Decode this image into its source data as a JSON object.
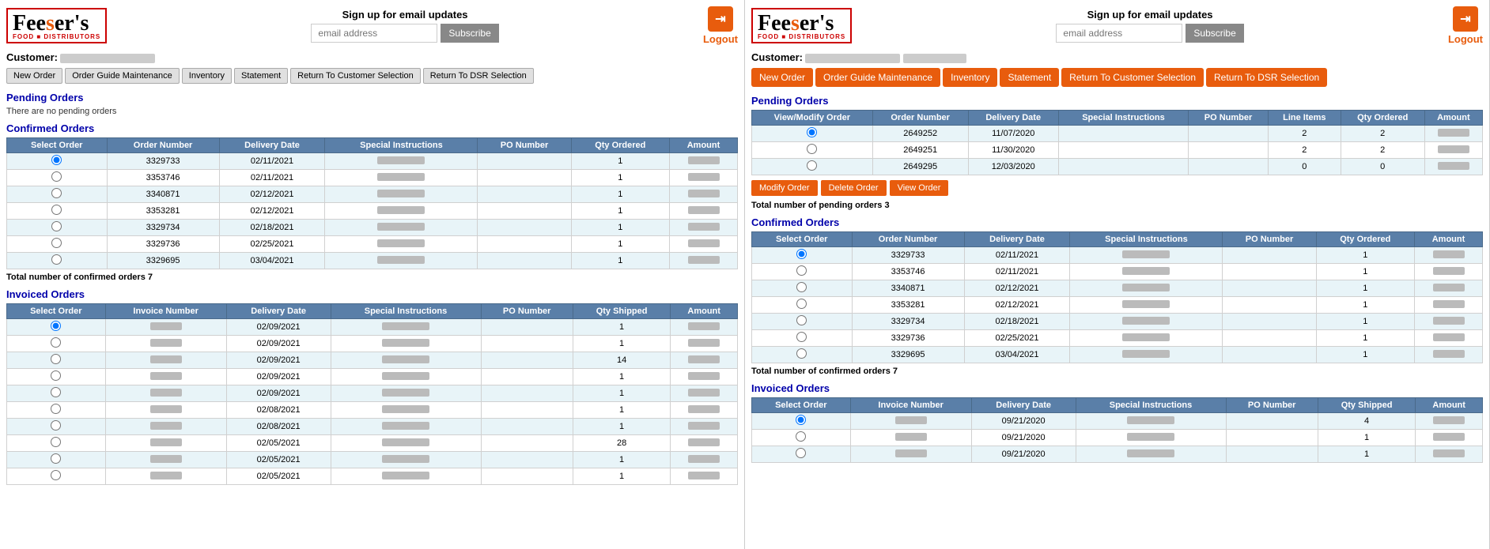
{
  "header": {
    "signup_title": "Sign up for email updates",
    "email_placeholder": "email address",
    "subscribe_label": "Subscribe",
    "logout_label": "Logout"
  },
  "customer": {
    "label": "Customer:"
  },
  "nav_left": {
    "buttons": [
      "New Order",
      "Order Guide Maintenance",
      "Inventory",
      "Statement",
      "Return To Customer Selection",
      "Return To DSR Selection"
    ]
  },
  "nav_right": {
    "buttons": [
      "New Order",
      "Order Guide Maintenance",
      "Inventory",
      "Statement",
      "Return To Customer Selection",
      "Return To DSR Selection"
    ]
  },
  "pending_orders": {
    "title": "Pending Orders",
    "note_left": "There are no pending orders",
    "columns_right": [
      "View/Modify Order",
      "Order Number",
      "Delivery Date",
      "Special Instructions",
      "PO Number",
      "Line Items",
      "Qty Ordered",
      "Amount"
    ],
    "rows_right": [
      {
        "order_number": "2649252",
        "delivery_date": "11/07/2020",
        "line_items": "2",
        "qty_ordered": "2"
      },
      {
        "order_number": "2649251",
        "delivery_date": "11/30/2020",
        "line_items": "2",
        "qty_ordered": "2"
      },
      {
        "order_number": "2649295",
        "delivery_date": "12/03/2020",
        "line_items": "0",
        "qty_ordered": "0"
      }
    ],
    "total_right": "Total number of pending orders 3",
    "action_buttons": [
      "Modify Order",
      "Delete Order",
      "View Order"
    ]
  },
  "confirmed_orders": {
    "title": "Confirmed Orders",
    "columns": [
      "Select Order",
      "Order Number",
      "Delivery Date",
      "Special Instructions",
      "PO Number",
      "Qty Ordered",
      "Amount"
    ],
    "rows": [
      {
        "order_number": "3329733",
        "delivery_date": "02/11/2021",
        "qty_ordered": "1"
      },
      {
        "order_number": "3353746",
        "delivery_date": "02/11/2021",
        "qty_ordered": "1"
      },
      {
        "order_number": "3340871",
        "delivery_date": "02/12/2021",
        "qty_ordered": "1"
      },
      {
        "order_number": "3353281",
        "delivery_date": "02/12/2021",
        "qty_ordered": "1"
      },
      {
        "order_number": "3329734",
        "delivery_date": "02/18/2021",
        "qty_ordered": "1"
      },
      {
        "order_number": "3329736",
        "delivery_date": "02/25/2021",
        "qty_ordered": "1"
      },
      {
        "order_number": "3329695",
        "delivery_date": "03/04/2021",
        "qty_ordered": "1"
      }
    ],
    "total": "Total number of confirmed orders 7"
  },
  "invoiced_orders": {
    "title": "Invoiced Orders",
    "columns_left": [
      "Select Order",
      "Invoice Number",
      "Delivery Date",
      "Special Instructions",
      "PO Number",
      "Qty Shipped",
      "Amount"
    ],
    "rows_left": [
      {
        "delivery_date": "02/09/2021",
        "qty_shipped": "1"
      },
      {
        "delivery_date": "02/09/2021",
        "qty_shipped": "1"
      },
      {
        "delivery_date": "02/09/2021",
        "qty_shipped": "14"
      },
      {
        "delivery_date": "02/09/2021",
        "qty_shipped": "1"
      },
      {
        "delivery_date": "02/09/2021",
        "qty_shipped": "1"
      },
      {
        "delivery_date": "02/08/2021",
        "qty_shipped": "1"
      },
      {
        "delivery_date": "02/08/2021",
        "qty_shipped": "1"
      },
      {
        "delivery_date": "02/05/2021",
        "qty_shipped": "28"
      },
      {
        "delivery_date": "02/05/2021",
        "qty_shipped": "1"
      },
      {
        "delivery_date": "02/05/2021",
        "qty_shipped": "1"
      }
    ],
    "columns_right": [
      "Select Order",
      "Invoice Number",
      "Delivery Date",
      "Special Instructions",
      "PO Number",
      "Qty Shipped",
      "Amount"
    ],
    "rows_right": [
      {
        "delivery_date": "09/21/2020",
        "qty_shipped": "4"
      },
      {
        "delivery_date": "09/21/2020",
        "qty_shipped": "1"
      },
      {
        "delivery_date": "09/21/2020",
        "qty_shipped": "1"
      }
    ]
  }
}
